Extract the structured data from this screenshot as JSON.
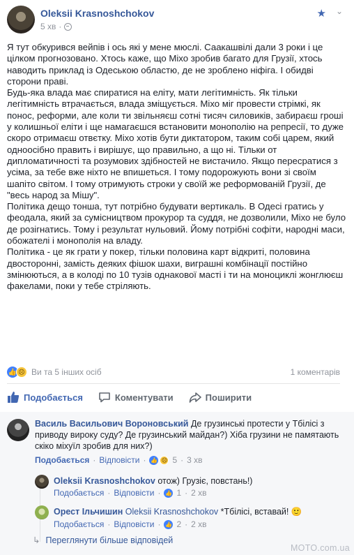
{
  "post": {
    "author": "Oleksii Krasnoshchokov",
    "time": "5 хв",
    "body": [
      "Я тут обкурився вейпів і ось які у мене мюслі. Саакашвілі дали 3 роки і це цілком прогнозовано. Хтось каже, що Міхо зробив багато для Грузії, хтось наводить приклад із Одеською областю, де не зроблено ніфіга. І обидві сторони праві.",
      "Будь-яка влада має спиратися на еліту, мати легітимність. Як тільки легітимність втрачається, влада зміщується. Міхо міг провести стрімкі, як понос, реформи, але коли ти звільняєш сотні тисяч силовиків, забираєш гроші у колишньої еліти і ще намагаєшся встановити монополію на репресії, то дуже скоро отримаєш отвєтку. Міхо хотів бути диктатором, таким собі царем, який одноосібно править і вирішує, що правильно, а що ні. Тільки от дипломатичності та розумових здібностей не вистачило. Якщо пересратися з усіма, за тебе вже ніхто не впишеться. І тому подорожують вони зі своїм шапіто світом. І тому отримують строки у своїй же реформованій Грузії, де \"весь народ за Мішу\".",
      "Політика дещо тонша, тут потрібно будувати вертикаль. В Одесі гратись у феодала, який за сумісництвом прокурор та суддя, не дозволили, Міхо не було де розігнатись. Тому і результат нульовий. Йому потрібні софіти, народні маси, обожателі і монополія на владу.",
      "Політика - це як грати у покер, тільки половина карт відкриті, половина двосторонні, замість деяких фішок шахи, виграшні комбінації постійно змінюються, а в колоді по 10 тузів однакової масті і ти на моноциклі жонглюєш факелами, поки у тебе стріляють."
    ]
  },
  "reactions": {
    "summary": "Ви та 5 інших осіб",
    "comments_count": "1 коментарів"
  },
  "actions": {
    "like": "Подобається",
    "comment": "Коментувати",
    "share": "Поширити"
  },
  "comments": [
    {
      "author": "Василь Васильович Вороновський",
      "text": "Де грузинські протести у Тбілісі з приводу вироку суду? Де грузинський майдан?) Хіба грузини не памятають скіко міхуїл зробив для них?)",
      "like": "Подобається",
      "reply": "Відповісти",
      "reactions": "5",
      "time": "3 хв"
    },
    {
      "author": "Oleksii Krasnoshchokov",
      "text": "отож) Грузіє, повстань!)",
      "like": "Подобається",
      "reply": "Відповісти",
      "reactions": "1",
      "time": "2 хв"
    },
    {
      "author": "Орест Ільчишин",
      "mention": "Oleksii Krasnoshchokov",
      "text": "*Тбілісі, вставай!",
      "emoji": "🙂",
      "like": "Подобається",
      "reply": "Відповісти",
      "reactions": "2",
      "time": "2 хв"
    }
  ],
  "more_replies": "Переглянути більше відповідей",
  "watermark": "MOTO.com.ua",
  "colors": {
    "link": "#365899",
    "like_blue": "#4267b2",
    "muted": "#90949c",
    "comments_bg": "#f6f7f9"
  }
}
